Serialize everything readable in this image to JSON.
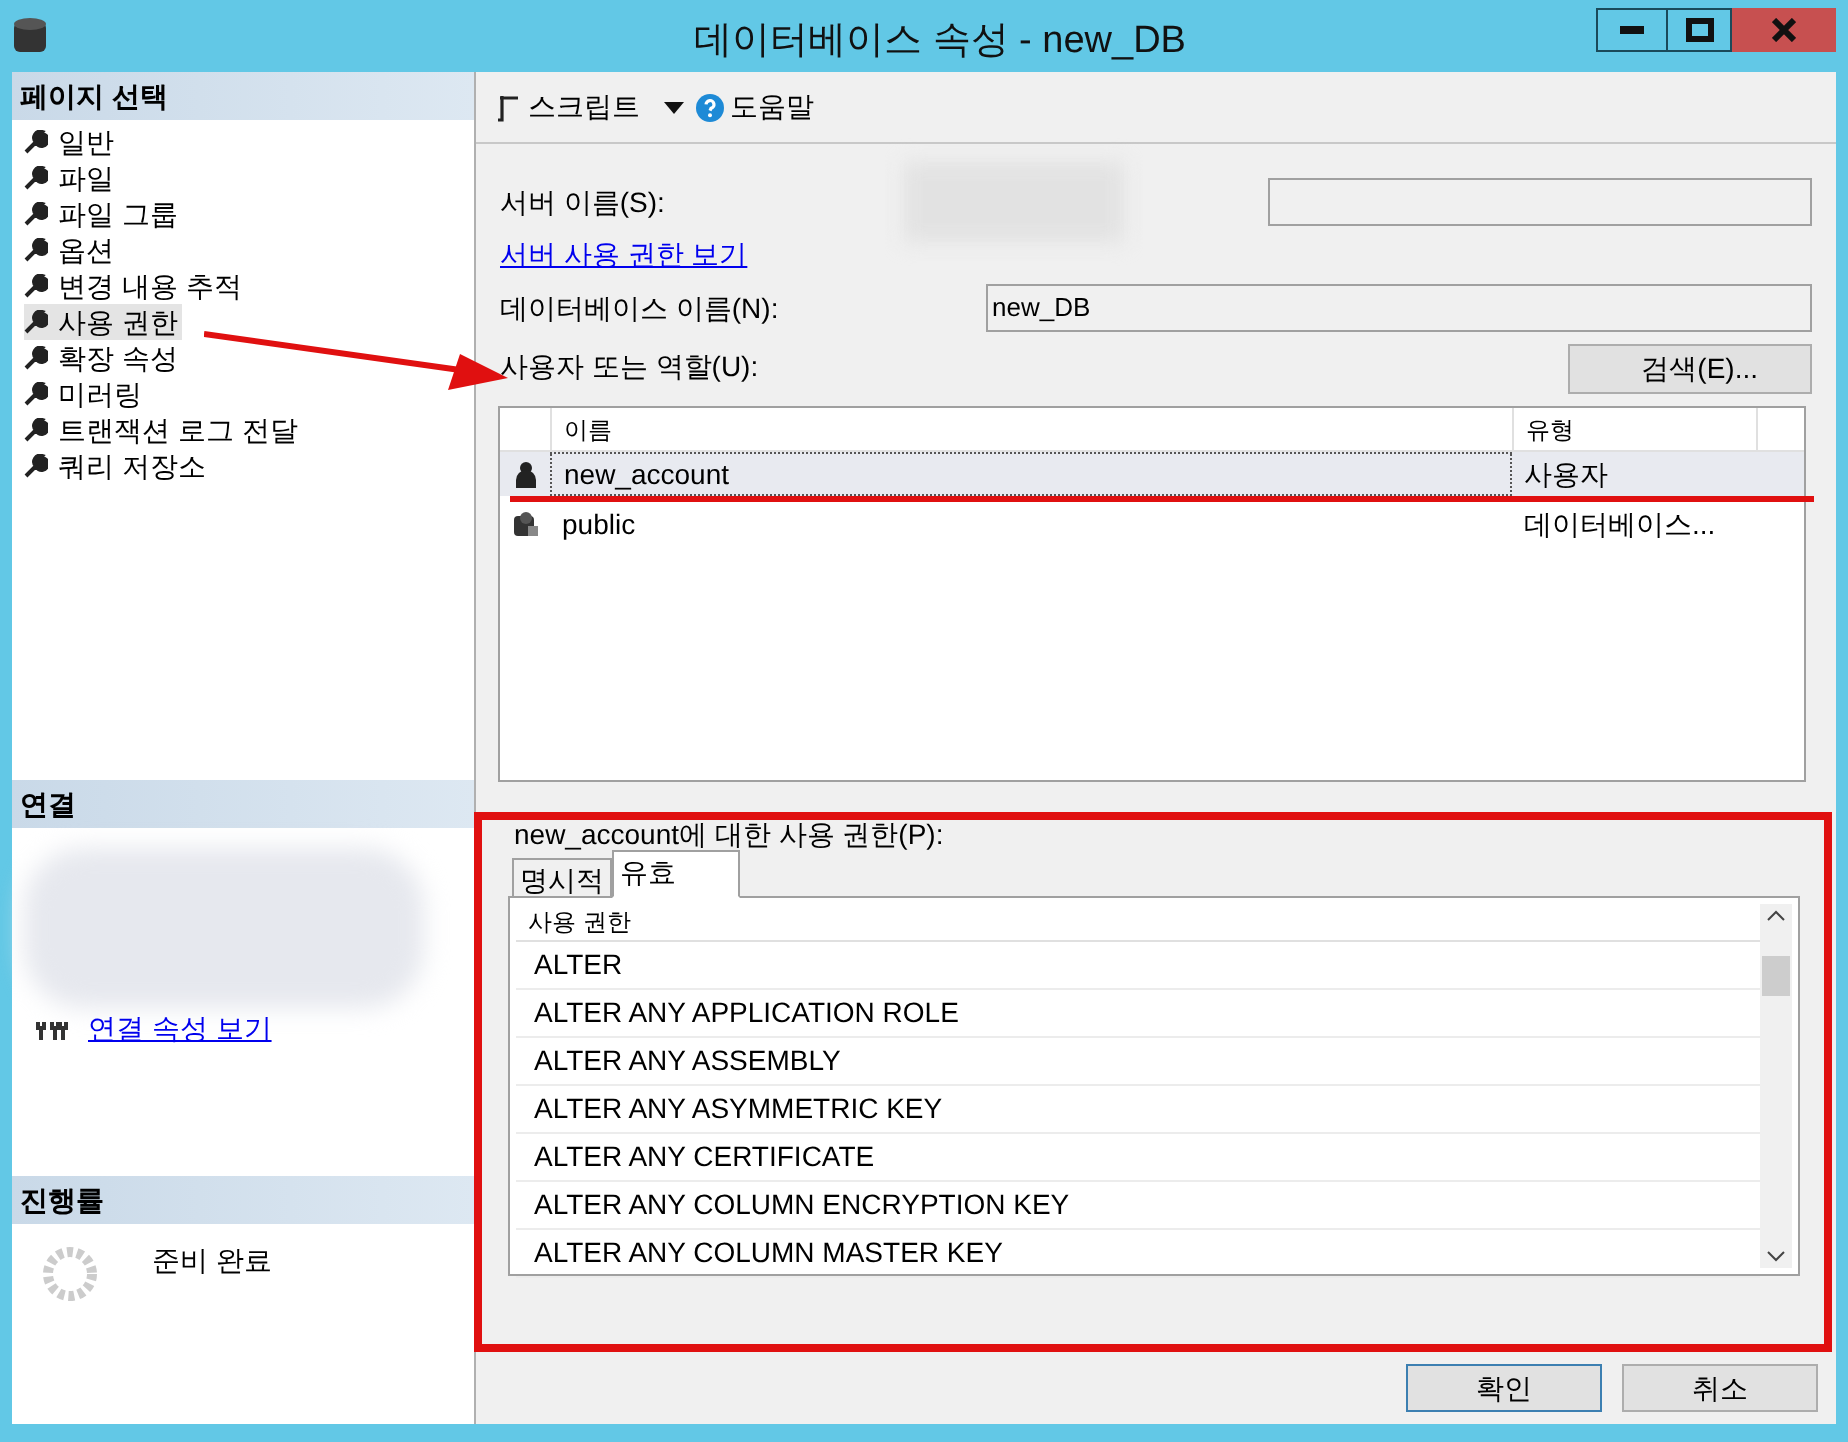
{
  "window": {
    "title": "데이터베이스 속성 - new_DB"
  },
  "sidebar": {
    "title": "페이지 선택",
    "items": [
      {
        "label": "일반",
        "selected": false
      },
      {
        "label": "파일",
        "selected": false
      },
      {
        "label": "파일 그룹",
        "selected": false
      },
      {
        "label": "옵션",
        "selected": false
      },
      {
        "label": "변경 내용 추적",
        "selected": false
      },
      {
        "label": "사용 권한",
        "selected": true
      },
      {
        "label": "확장 속성",
        "selected": false
      },
      {
        "label": "미러링",
        "selected": false
      },
      {
        "label": "트랜잭션 로그 전달",
        "selected": false
      },
      {
        "label": "쿼리 저장소",
        "selected": false
      }
    ]
  },
  "connection": {
    "title": "연결",
    "link": "연결 속성 보기"
  },
  "progress": {
    "title": "진행률",
    "status": "준비 완료"
  },
  "toolbar": {
    "script": "스크립트",
    "help": "도움말"
  },
  "form": {
    "server_label": "서버 이름(S):",
    "server_link": "서버 사용 권한 보기",
    "db_label": "데이터베이스 이름(N):",
    "db_value": "new_DB",
    "users_label": "사용자 또는 역할(U):",
    "search_button": "검색(E)..."
  },
  "users": {
    "columns": [
      "이름",
      "유형"
    ],
    "rows": [
      {
        "kind": "user",
        "name": "new_account",
        "type": "사용자",
        "selected": true
      },
      {
        "kind": "role",
        "name": "public",
        "type": "데이터베이스...",
        "selected": false
      }
    ]
  },
  "permissions": {
    "label": "new_account에 대한 사용 권한(P):",
    "tabs": [
      {
        "label": "명시적",
        "selected": false
      },
      {
        "label": "유효",
        "selected": true
      }
    ],
    "column": "사용 권한",
    "rows": [
      "ALTER",
      "ALTER ANY APPLICATION ROLE",
      "ALTER ANY ASSEMBLY",
      "ALTER ANY ASYMMETRIC KEY",
      "ALTER ANY CERTIFICATE",
      "ALTER ANY COLUMN ENCRYPTION KEY",
      "ALTER ANY COLUMN MASTER KEY"
    ]
  },
  "buttons": [
    "확인",
    "취소"
  ]
}
